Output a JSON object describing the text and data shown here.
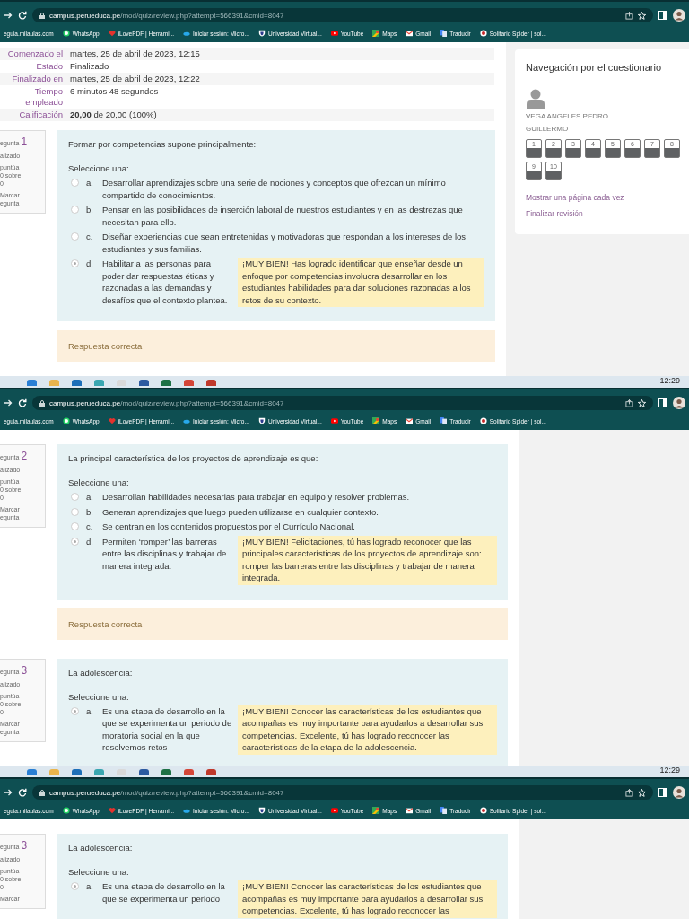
{
  "captures": [
    {
      "browser": {
        "url_domain": "campus.perueduca.pe",
        "url_path": "/mod/quiz/review.php?attempt=566391&cmid=8047",
        "bookmarks": [
          {
            "label": "eguia.milaulas.com",
            "kind": "none"
          },
          {
            "label": "WhatsApp",
            "kind": "chat"
          },
          {
            "label": "iLovePDF | Herrami...",
            "kind": "heart"
          },
          {
            "label": "Iniciar sesión: Micro...",
            "kind": "cloud"
          },
          {
            "label": "Universidad Virtual...",
            "kind": "shield"
          },
          {
            "label": "YouTube",
            "kind": "play"
          },
          {
            "label": "Maps",
            "kind": "map"
          },
          {
            "label": "Gmail",
            "kind": "mail"
          },
          {
            "label": "Traducir",
            "kind": "translate"
          },
          {
            "label": "Solitario Spider | sol...",
            "kind": "cards"
          }
        ]
      },
      "summary": [
        {
          "label": "Comenzado el",
          "value": "martes, 25 de abril de 2023, 12:15"
        },
        {
          "label": "Estado",
          "value": "Finalizado"
        },
        {
          "label": "Finalizado en",
          "value": "martes, 25 de abril de 2023, 12:22"
        },
        {
          "label": "Tiempo empleado",
          "value": "6 minutos 48 segundos"
        },
        {
          "label": "Calificación",
          "value": "**20,00** de 20,00 (100%)"
        }
      ],
      "questions": [
        {
          "number_label": "egunta",
          "number": "1",
          "status": "alizado",
          "score": [
            "puntúa",
            "0 sobre",
            "0"
          ],
          "flag": [
            "Marcar",
            "egunta"
          ],
          "prompt": "Formar por competencias supone principalmente:",
          "select_label": "Seleccione una:",
          "options": [
            {
              "letter": "a.",
              "text": "Desarrollar aprendizajes sobre una serie de nociones y conceptos que ofrezcan un mínimo compartido de conocimientos.",
              "selected": false
            },
            {
              "letter": "b.",
              "text": "Pensar en las posibilidades de inserción laboral de nuestros estudiantes y en las destrezas que necesitan para ello.",
              "selected": false
            },
            {
              "letter": "c.",
              "text": "Diseñar experiencias que sean entretenidas y motivadoras que respondan a los intereses de los estudiantes y sus familias.",
              "selected": false
            },
            {
              "letter": "d.",
              "text": "Habilitar a las personas para poder dar respuestas éticas y razonadas a las demandas y desafíos que el contexto plantea.",
              "selected": true,
              "feedback": "¡MUY BIEN! Has logrado identificar que enseñar desde un enfoque por competencias involucra desarrollar en los estudiantes habilidades para dar soluciones razonadas a los retos de su contexto."
            }
          ],
          "outcome": "Respuesta correcta"
        }
      ],
      "nav": {
        "title": "Navegación por el cuestionario",
        "user": "VEGA ANGELES PEDRO GUILLERMO",
        "buttons": [
          {
            "label": "1",
            "answered": true
          },
          {
            "label": "2",
            "answered": true
          },
          {
            "label": "3",
            "answered": true
          },
          {
            "label": "4",
            "answered": true
          },
          {
            "label": "5",
            "answered": true
          },
          {
            "label": "6",
            "answered": true
          },
          {
            "label": "7",
            "answered": true
          },
          {
            "label": "8",
            "answered": true
          },
          {
            "label": "9",
            "answered": true
          },
          {
            "label": "10",
            "answered": true
          }
        ],
        "links": [
          "Mostrar una página cada vez",
          "Finalizar revisión"
        ]
      },
      "taskbar": {
        "time": "12:29"
      }
    },
    {
      "browser": {
        "url_domain": "campus.perueduca.pe",
        "url_path": "/mod/quiz/review.php?attempt=566391&cmid=8047",
        "bookmarks": [
          {
            "label": "eguia.milaulas.com",
            "kind": "none"
          },
          {
            "label": "WhatsApp",
            "kind": "chat"
          },
          {
            "label": "iLovePDF | Herrami...",
            "kind": "heart"
          },
          {
            "label": "Iniciar sesión: Micro...",
            "kind": "cloud"
          },
          {
            "label": "Universidad Virtual...",
            "kind": "shield"
          },
          {
            "label": "YouTube",
            "kind": "play"
          },
          {
            "label": "Maps",
            "kind": "map"
          },
          {
            "label": "Gmail",
            "kind": "mail"
          },
          {
            "label": "Traducir",
            "kind": "translate"
          },
          {
            "label": "Solitario Spider | sol...",
            "kind": "cards"
          }
        ]
      },
      "questions": [
        {
          "number_label": "egunta",
          "number": "2",
          "status": "alizado",
          "score": [
            "puntúa",
            "0 sobre",
            "0"
          ],
          "flag": [
            "Marcar",
            "egunta"
          ],
          "prompt": "La principal característica de los proyectos de aprendizaje es que:",
          "select_label": "Seleccione una:",
          "options": [
            {
              "letter": "a.",
              "text": "Desarrollan habilidades necesarias para trabajar en equipo y resolver problemas.",
              "selected": false
            },
            {
              "letter": "b.",
              "text": "Generan aprendizajes que luego pueden utilizarse en cualquier contexto.",
              "selected": false
            },
            {
              "letter": "c.",
              "text": "Se centran en los contenidos propuestos por el Currículo Nacional.",
              "selected": false
            },
            {
              "letter": "d.",
              "text": "Permiten ‘romper’ las barreras entre las disciplinas y trabajar de manera integrada.",
              "selected": true,
              "feedback": "¡MUY BIEN! Felicitaciones, tú has logrado reconocer que las principales características de los proyectos de aprendizaje son: romper las barreras entre las disciplinas y trabajar de manera integrada."
            }
          ],
          "outcome": "Respuesta correcta"
        },
        {
          "number_label": "egunta",
          "number": "3",
          "status": "alizado",
          "score": [
            "puntúa",
            "0 sobre",
            "0"
          ],
          "flag": [
            "Marcar",
            "egunta"
          ],
          "prompt": "La adolescencia:",
          "select_label": "Seleccione una:",
          "options": [
            {
              "letter": "a.",
              "text": "Es una etapa de desarrollo en la que se experimenta un periodo de moratoria social en la que resolvemos retos",
              "selected": true,
              "feedback": "¡MUY BIEN! Conocer las características de los estudiantes que acompañas es muy importante para ayudarlos a desarrollar sus competencias. Excelente, tú has logrado reconocer las características de la etapa de la adolescencia."
            }
          ]
        }
      ],
      "taskbar": {
        "time": "12:29"
      }
    },
    {
      "browser": {
        "url_domain": "campus.perueduca.pe",
        "url_path": "/mod/quiz/review.php?attempt=566391&cmid=8047",
        "bookmarks": [
          {
            "label": "eguia.milaulas.com",
            "kind": "none"
          },
          {
            "label": "WhatsApp",
            "kind": "chat"
          },
          {
            "label": "iLovePDF | Herrami...",
            "kind": "heart"
          },
          {
            "label": "Iniciar sesión: Micro...",
            "kind": "cloud"
          },
          {
            "label": "Universidad Virtual...",
            "kind": "shield"
          },
          {
            "label": "YouTube",
            "kind": "play"
          },
          {
            "label": "Maps",
            "kind": "map"
          },
          {
            "label": "Gmail",
            "kind": "mail"
          },
          {
            "label": "Traducir",
            "kind": "translate"
          },
          {
            "label": "Solitario Spider | sol...",
            "kind": "cards"
          }
        ]
      },
      "questions": [
        {
          "number_label": "egunta",
          "number": "3",
          "status": "alizado",
          "score": [
            "puntúa",
            "0 sobre",
            "0"
          ],
          "flag": [
            "Marcar"
          ],
          "prompt": "La adolescencia:",
          "select_label": "Seleccione una:",
          "options": [
            {
              "letter": "a.",
              "text": "Es una etapa de desarrollo en la que se experimenta un periodo",
              "selected": true,
              "feedback": "¡MUY BIEN! Conocer las características de los estudiantes que acompañas es muy importante para ayudarlos a desarrollar sus competencias. Excelente, tú has logrado reconocer las"
            }
          ]
        }
      ]
    }
  ]
}
